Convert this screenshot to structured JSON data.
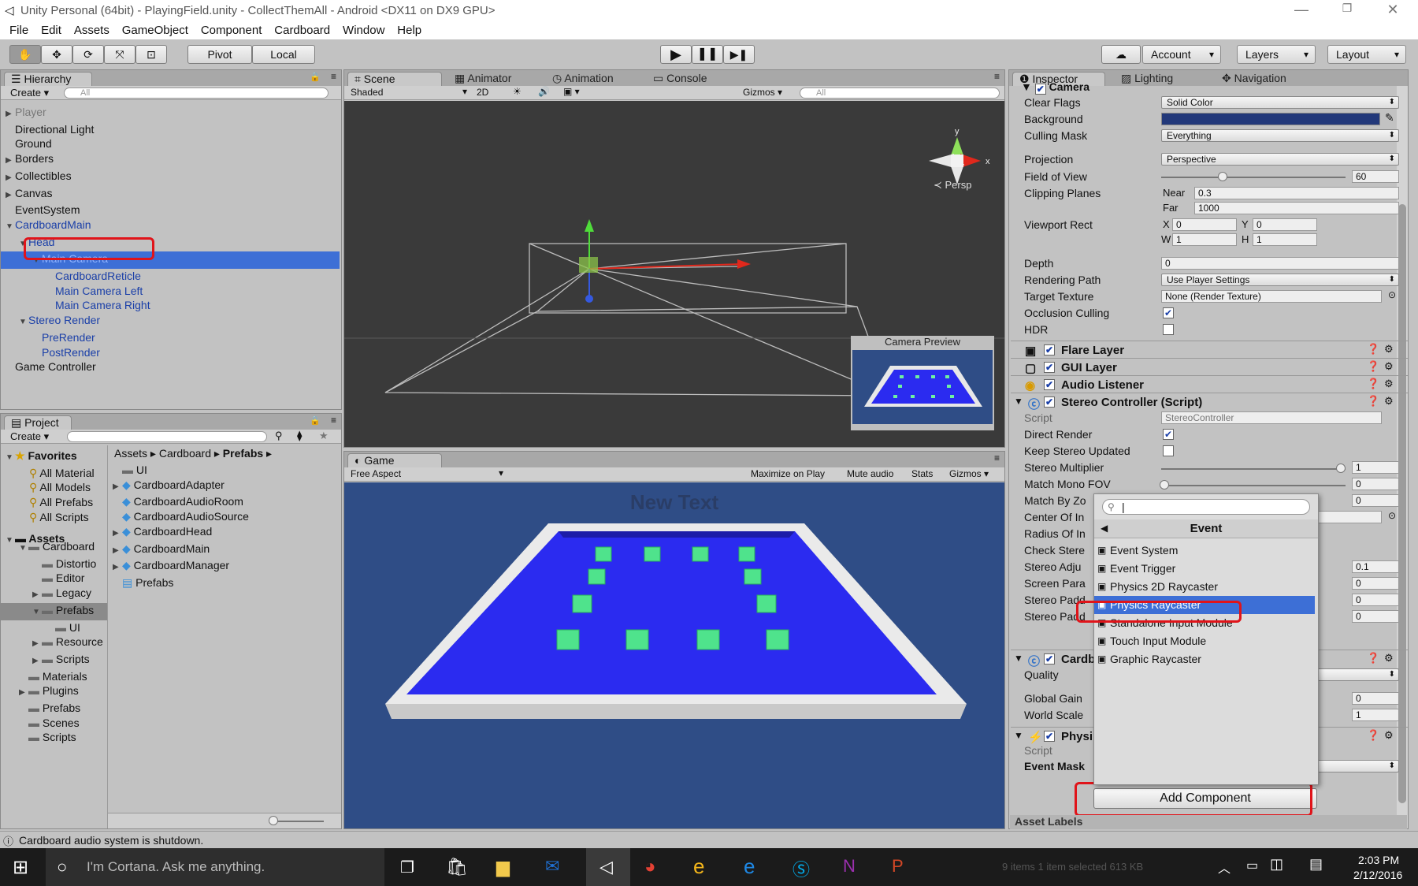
{
  "window": {
    "title": "Unity Personal (64bit) - PlayingField.unity - CollectThemAll - Android <DX11 on DX9 GPU>"
  },
  "menu": [
    "File",
    "Edit",
    "Assets",
    "GameObject",
    "Component",
    "Cardboard",
    "Window",
    "Help"
  ],
  "toolbar": {
    "pivot": "Pivot",
    "local": "Local",
    "account": "Account",
    "layers": "Layers",
    "layout": "Layout"
  },
  "hierarchy": {
    "tab": "Hierarchy",
    "create": "Create",
    "search_placeholder": "All",
    "items": [
      {
        "label": "Player",
        "indent": 0,
        "arrow": "right",
        "style": "dim"
      },
      {
        "label": "Directional Light",
        "indent": 0,
        "arrow": "",
        "style": "normal"
      },
      {
        "label": "Ground",
        "indent": 0,
        "arrow": "",
        "style": "normal"
      },
      {
        "label": "Borders",
        "indent": 0,
        "arrow": "right",
        "style": "normal"
      },
      {
        "label": "Collectibles",
        "indent": 0,
        "arrow": "right",
        "style": "normal"
      },
      {
        "label": "Canvas",
        "indent": 0,
        "arrow": "right",
        "style": "normal"
      },
      {
        "label": "EventSystem",
        "indent": 0,
        "arrow": "",
        "style": "normal"
      },
      {
        "label": "CardboardMain",
        "indent": 0,
        "arrow": "down",
        "style": "blue"
      },
      {
        "label": "Head",
        "indent": 1,
        "arrow": "down",
        "style": "blue"
      },
      {
        "label": "Main Camera",
        "indent": 2,
        "arrow": "down",
        "style": "selected"
      },
      {
        "label": "CardboardReticle",
        "indent": 3,
        "arrow": "",
        "style": "blue"
      },
      {
        "label": "Main Camera Left",
        "indent": 3,
        "arrow": "",
        "style": "blue"
      },
      {
        "label": "Main Camera Right",
        "indent": 3,
        "arrow": "",
        "style": "blue"
      },
      {
        "label": "Stereo Render",
        "indent": 1,
        "arrow": "down",
        "style": "blue"
      },
      {
        "label": "PreRender",
        "indent": 2,
        "arrow": "",
        "style": "blue"
      },
      {
        "label": "PostRender",
        "indent": 2,
        "arrow": "",
        "style": "blue"
      },
      {
        "label": "Game Controller",
        "indent": 0,
        "arrow": "",
        "style": "normal"
      }
    ]
  },
  "project": {
    "tab": "Project",
    "create": "Create",
    "favorites_title": "Favorites",
    "favorites": [
      "All Material",
      "All Models",
      "All Prefabs",
      "All Scripts"
    ],
    "assets_title": "Assets",
    "folders": [
      {
        "label": "Cardboard",
        "indent": 1,
        "arrow": "down"
      },
      {
        "label": "Distortio",
        "indent": 2,
        "arrow": ""
      },
      {
        "label": "Editor",
        "indent": 2,
        "arrow": ""
      },
      {
        "label": "Legacy",
        "indent": 2,
        "arrow": "right"
      },
      {
        "label": "Prefabs",
        "indent": 2,
        "arrow": "down",
        "selected": true
      },
      {
        "label": "UI",
        "indent": 3,
        "arrow": ""
      },
      {
        "label": "Resource",
        "indent": 2,
        "arrow": "right"
      },
      {
        "label": "Scripts",
        "indent": 2,
        "arrow": "right"
      },
      {
        "label": "Materials",
        "indent": 1,
        "arrow": ""
      },
      {
        "label": "Plugins",
        "indent": 1,
        "arrow": "right"
      },
      {
        "label": "Prefabs",
        "indent": 1,
        "arrow": ""
      },
      {
        "label": "Scenes",
        "indent": 1,
        "arrow": ""
      },
      {
        "label": "Scripts",
        "indent": 1,
        "arrow": ""
      }
    ],
    "breadcrumb": [
      "Assets",
      "Cardboard",
      "Prefabs"
    ],
    "files": [
      {
        "label": "UI",
        "type": "folder",
        "arrow": ""
      },
      {
        "label": "CardboardAdapter",
        "type": "prefab",
        "arrow": "right"
      },
      {
        "label": "CardboardAudioRoom",
        "type": "prefab",
        "arrow": ""
      },
      {
        "label": "CardboardAudioSource",
        "type": "prefab",
        "arrow": ""
      },
      {
        "label": "CardboardHead",
        "type": "prefab",
        "arrow": "right"
      },
      {
        "label": "CardboardMain",
        "type": "prefab",
        "arrow": "right"
      },
      {
        "label": "CardboardManager",
        "type": "prefab",
        "arrow": "right"
      },
      {
        "label": "Prefabs",
        "type": "script",
        "arrow": ""
      }
    ]
  },
  "scene": {
    "tabs": [
      "Scene",
      "Animator",
      "Animation",
      "Console"
    ],
    "shaded": "Shaded",
    "mode2d": "2D",
    "gizmos": "Gizmos",
    "search_placeholder": "All",
    "persp": "Persp",
    "camera_preview": "Camera Preview"
  },
  "game": {
    "tab": "Game",
    "aspect": "Free Aspect",
    "maximize": "Maximize on Play",
    "mute": "Mute audio",
    "stats": "Stats",
    "gizmos": "Gizmos",
    "overlay_text": "New Text"
  },
  "inspector": {
    "tabs": [
      "Inspector",
      "Lighting",
      "Navigation"
    ],
    "camera_title": "Camera",
    "rows": {
      "clear_flags": {
        "label": "Clear Flags",
        "value": "Solid Color"
      },
      "background": {
        "label": "Background",
        "color": "#22387a"
      },
      "culling_mask": {
        "label": "Culling Mask",
        "value": "Everything"
      },
      "projection": {
        "label": "Projection",
        "value": "Perspective"
      },
      "fov": {
        "label": "Field of View",
        "value": "60"
      },
      "clipping": {
        "label": "Clipping Planes",
        "near_label": "Near",
        "near": "0.3",
        "far_label": "Far",
        "far": "1000"
      },
      "viewport": {
        "label": "Viewport Rect",
        "x": "0",
        "y": "0",
        "w": "1",
        "h": "1"
      },
      "depth": {
        "label": "Depth",
        "value": "0"
      },
      "rendering_path": {
        "label": "Rendering Path",
        "value": "Use Player Settings"
      },
      "target_texture": {
        "label": "Target Texture",
        "value": "None (Render Texture)"
      },
      "occlusion": {
        "label": "Occlusion Culling"
      },
      "hdr": {
        "label": "HDR"
      }
    },
    "components": [
      "Flare Layer",
      "GUI Layer",
      "Audio Listener",
      "Stereo Controller (Script)"
    ],
    "stereo": {
      "script_label": "Script",
      "script_value": "StereoController",
      "direct_render": "Direct Render",
      "keep_updated": "Keep Stereo Updated",
      "multiplier": "Stereo Multiplier",
      "multiplier_value": "1",
      "mono_fov": "Match Mono FOV",
      "mono_fov_value": "0",
      "match_by": "Match By Zo",
      "match_by_value": "0",
      "center": "Center Of In",
      "radius": "Radius Of In",
      "check": "Check Stere",
      "adjust": "Stereo Adju",
      "adjust_value": "0.1",
      "screen_para": "Screen Para",
      "screen_para_value": "0",
      "padding1": "Stereo Padd",
      "padding1_value": "0",
      "padding2": "Stereo Padd",
      "padding2_value": "0"
    },
    "cardboard": {
      "title": "Cardb",
      "quality": "Quality",
      "gain": "Global Gain",
      "gain_value": "0",
      "scale": "World Scale",
      "scale_value": "1"
    },
    "physics": {
      "title": "Physi",
      "script": "Script",
      "mask": "Event Mask"
    },
    "add_component": "Add Component",
    "asset_labels": "Asset Labels"
  },
  "popup": {
    "header": "Event",
    "items": [
      "Event System",
      "Event Trigger",
      "Physics 2D Raycaster",
      "Physics Raycaster",
      "Standalone Input Module",
      "Touch Input Module",
      "Graphic Raycaster"
    ],
    "selected_index": 3
  },
  "status": {
    "message": "Cardboard audio system is shutdown.",
    "right_info": "9 items      1 item selected   613 KB"
  },
  "taskbar": {
    "cortana": "I'm Cortana. Ask me anything.",
    "time": "2:03 PM",
    "date": "2/12/2016"
  },
  "colors": {
    "selection": "#3d6fd6",
    "highlight_red": "#e0141a",
    "game_bg": "#2f4d86",
    "floor": "#2b2bf0"
  }
}
